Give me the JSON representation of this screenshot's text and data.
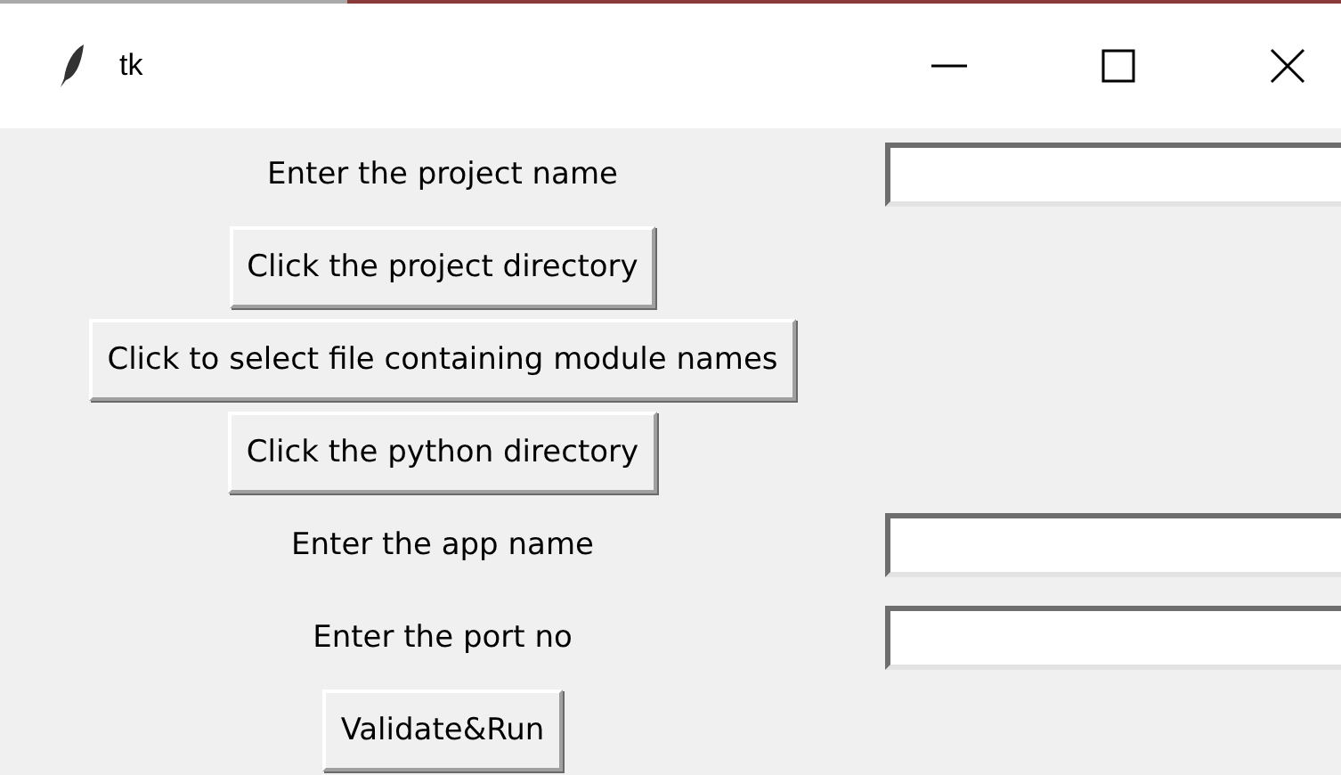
{
  "window": {
    "title": "tk"
  },
  "rows": [
    {
      "kind": "entry",
      "label": "Enter the project name"
    },
    {
      "kind": "button",
      "label": "Click the project directory"
    },
    {
      "kind": "button",
      "label": "Click to select file containing module names"
    },
    {
      "kind": "button",
      "label": "Click the python directory"
    },
    {
      "kind": "entry",
      "label": "Enter the app name"
    },
    {
      "kind": "entry",
      "label": "Enter the port no"
    },
    {
      "kind": "button",
      "label": "Validate&Run"
    }
  ]
}
